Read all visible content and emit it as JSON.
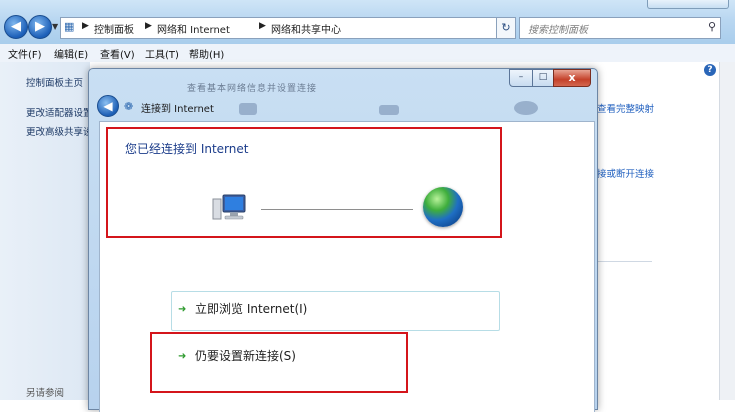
{
  "explorer": {
    "breadcrumbs": [
      "控制面板",
      "网络和 Internet",
      "网络和共享中心"
    ],
    "search_placeholder": "搜索控制面板",
    "menu": [
      "文件(F)",
      "编辑(E)",
      "查看(V)",
      "工具(T)",
      "帮助(H)"
    ],
    "left_links": [
      "控制面板主页",
      "更改适配器设置",
      "更改高级共享设置"
    ],
    "see_also": "另请参阅",
    "right_links": [
      "查看完整映射",
      "接或断开连接"
    ],
    "help_glyph": "?"
  },
  "dialog": {
    "blurred_title": "查看基本网络信息并设置连接",
    "title": "连接到 Internet",
    "status": "您已经连接到 Internet",
    "options": [
      {
        "label": "立即浏览 Internet(I)"
      },
      {
        "label": "仍要设置新连接(S)"
      }
    ],
    "controls": {
      "minimize": "–",
      "maximize": "□",
      "close": "x"
    }
  },
  "colors": {
    "highlight_red": "#d4151b",
    "link_blue": "#1f5fbf",
    "status_blue": "#1b3c8a",
    "arrow_green": "#2e9a2e"
  },
  "icons": {
    "nav_back": "back-arrow-icon",
    "nav_forward": "forward-arrow-icon",
    "network": "network-icon",
    "computer": "computer-icon",
    "globe": "internet-globe-icon"
  }
}
